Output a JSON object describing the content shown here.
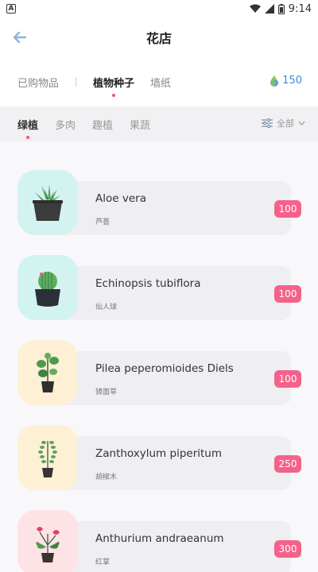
{
  "status": {
    "time": "9:14",
    "notification_icon": "A"
  },
  "header": {
    "title": "花店"
  },
  "tabs": [
    {
      "label": "已购物品"
    },
    {
      "label": "植物种子"
    },
    {
      "label": "墙纸"
    }
  ],
  "coins": {
    "count": "150"
  },
  "categories": [
    {
      "label": "绿植"
    },
    {
      "label": "多肉"
    },
    {
      "label": "趣植"
    },
    {
      "label": "果蔬"
    }
  ],
  "filter": {
    "label": "全部"
  },
  "items": [
    {
      "name": "Aloe vera",
      "sub": "芦荟",
      "price": "100",
      "thumb_color": "#d3f3f0"
    },
    {
      "name": "Echinopsis tubiflora",
      "sub": "仙人球",
      "price": "100",
      "thumb_color": "#d3f3f0"
    },
    {
      "name": "Pilea peperomioides Diels",
      "sub": "镜面草",
      "price": "100",
      "thumb_color": "#fdf0d5"
    },
    {
      "name": "Zanthoxylum piperitum",
      "sub": "胡椒木",
      "price": "250",
      "thumb_color": "#fdf0d5"
    },
    {
      "name": "Anthurium andraeanum",
      "sub": "红掌",
      "price": "300",
      "thumb_color": "#fde3e6"
    }
  ],
  "colors": {
    "accent": "#f4628a",
    "coin": "#3b8bd8",
    "dot": "#ff4d6d"
  }
}
